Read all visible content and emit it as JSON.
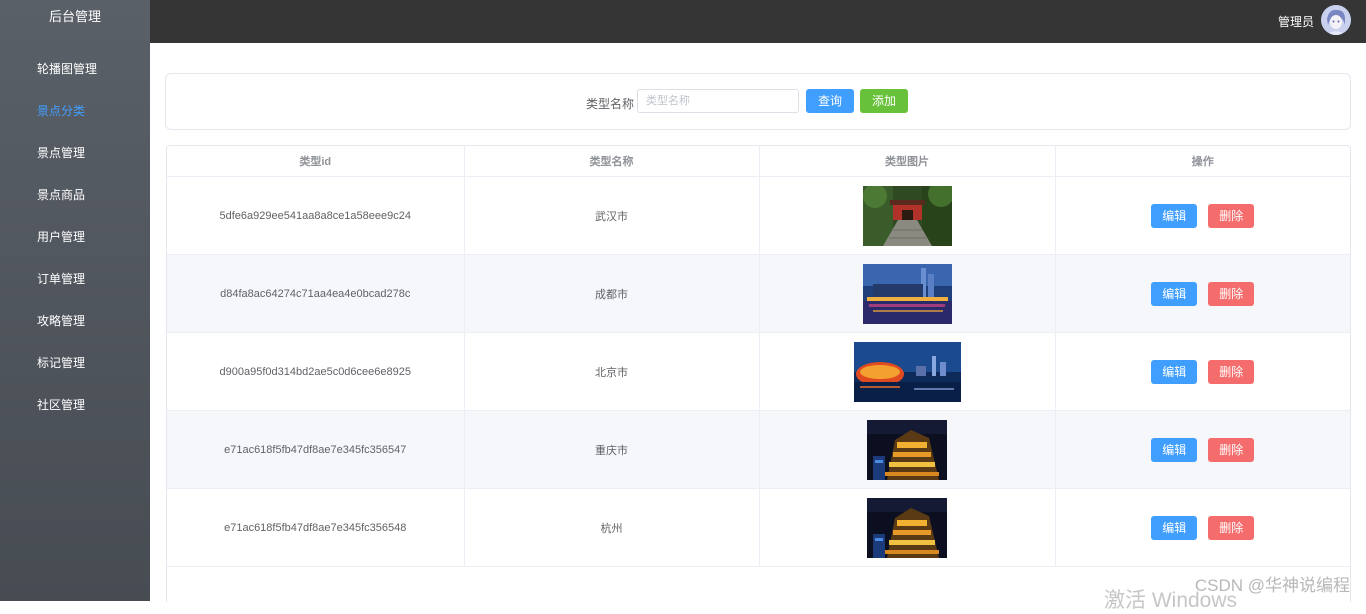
{
  "sidebar": {
    "title": "后台管理",
    "items": [
      {
        "label": "轮播图管理",
        "active": false
      },
      {
        "label": "景点分类",
        "active": true
      },
      {
        "label": "景点管理",
        "active": false
      },
      {
        "label": "景点商品",
        "active": false
      },
      {
        "label": "用户管理",
        "active": false
      },
      {
        "label": "订单管理",
        "active": false
      },
      {
        "label": "攻略管理",
        "active": false
      },
      {
        "label": "标记管理",
        "active": false
      },
      {
        "label": "社区管理",
        "active": false
      }
    ]
  },
  "header": {
    "user_name": "管理员",
    "avatar_icon": "user-avatar"
  },
  "search": {
    "label": "类型名称",
    "placeholder": "类型名称",
    "value": "",
    "query_label": "查询",
    "add_label": "添加"
  },
  "table": {
    "headers": [
      "类型id",
      "类型名称",
      "类型图片",
      "操作"
    ],
    "rows": [
      {
        "id": "5dfe6a929ee541aa8a8ce1a58eee9c24",
        "name": "武汉市",
        "image": "wuhan-gate-photo"
      },
      {
        "id": "d84fa8ac64274c71aa4ea4e0bcad278c",
        "name": "成都市",
        "image": "chengdu-night-photo"
      },
      {
        "id": "d900a95f0d314bd2ae5c0d6cee6e8925",
        "name": "北京市",
        "image": "beijing-birdsnest-photo"
      },
      {
        "id": "e71ac618f5fb47df8ae7e345fc356547",
        "name": "重庆市",
        "image": "chongqing-hongyadong-photo"
      },
      {
        "id": "e71ac618f5fb47df8ae7e345fc356548",
        "name": "杭州",
        "image": "hangzhou-night-photo"
      }
    ],
    "edit_label": "编辑",
    "delete_label": "删除"
  },
  "watermarks": {
    "csdn": "CSDN @华神说编程",
    "windows": "激活 Windows"
  },
  "colors": {
    "primary": "#409eff",
    "success": "#67c23a",
    "danger": "#f56c6c",
    "header_bg": "#353535",
    "sidebar_bg": "#52575e"
  }
}
